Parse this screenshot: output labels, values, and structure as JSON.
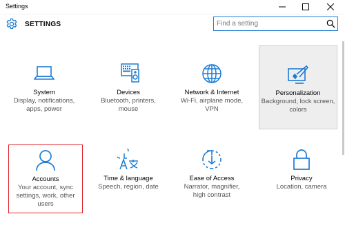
{
  "window": {
    "title": "Settings"
  },
  "header": {
    "title": "SETTINGS",
    "icon": "gear-icon"
  },
  "search": {
    "placeholder": "Find a setting",
    "value": ""
  },
  "colors": {
    "accent": "#1b7bd3",
    "selected_border": "#e0202a",
    "hover_background": "#eeeeee"
  },
  "tiles": [
    {
      "name": "System",
      "desc": "Display, notifications, apps, power",
      "icon": "laptop-icon"
    },
    {
      "name": "Devices",
      "desc": "Bluetooth, printers, mouse",
      "icon": "devices-icon"
    },
    {
      "name": "Network & Internet",
      "desc": "Wi-Fi, airplane mode, VPN",
      "icon": "globe-icon"
    },
    {
      "name": "Personalization",
      "desc": "Background, lock screen, colors",
      "icon": "paint-icon"
    },
    {
      "name": "Accounts",
      "desc": "Your account, sync settings, work, other users",
      "icon": "person-icon"
    },
    {
      "name": "Time & language",
      "desc": "Speech, region, date",
      "icon": "time-language-icon"
    },
    {
      "name": "Ease of Access",
      "desc": "Narrator, magnifier, high contrast",
      "icon": "ease-of-access-icon"
    },
    {
      "name": "Privacy",
      "desc": "Location, camera",
      "icon": "lock-icon"
    }
  ]
}
